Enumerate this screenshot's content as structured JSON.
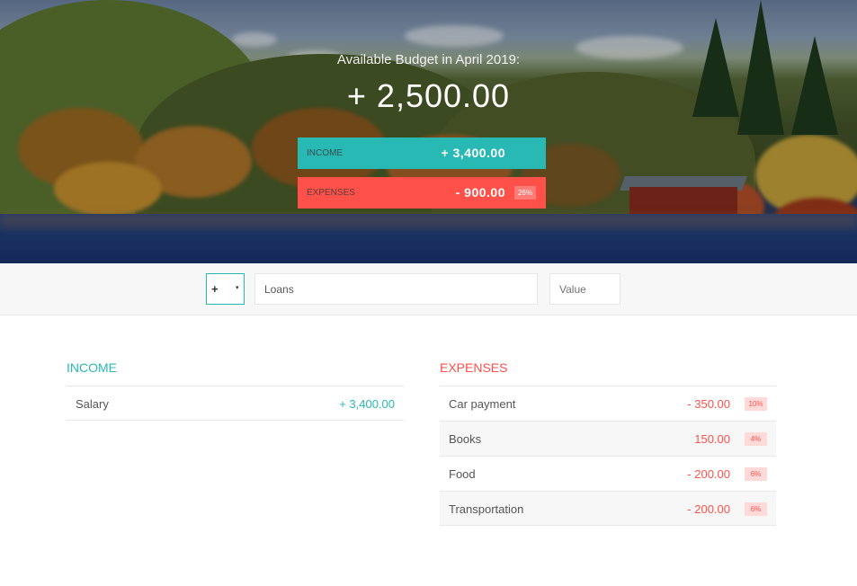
{
  "header": {
    "title": "Available Budget in April 2019:",
    "budget": "+ 2,500.00",
    "income": {
      "label": "Income",
      "value": "+ 3,400.00"
    },
    "expenses": {
      "label": "Expenses",
      "value": "- 900.00",
      "percentage": "26%"
    }
  },
  "add_form": {
    "type_value": "+",
    "type_caret": "▾",
    "description_value": "Loans",
    "value_placeholder": "Value"
  },
  "income": {
    "title": "Income",
    "items": [
      {
        "description": "Salary",
        "value": "+ 3,400.00"
      }
    ]
  },
  "expenses": {
    "title": "Expenses",
    "items": [
      {
        "description": "Car payment",
        "value": "- 350.00",
        "percentage": "10%"
      },
      {
        "description": "Books",
        "value": "150.00",
        "percentage": "4%"
      },
      {
        "description": "Food",
        "value": "- 200.00",
        "percentage": "6%"
      },
      {
        "description": "Transportation",
        "value": "- 200.00",
        "percentage": "6%"
      }
    ]
  },
  "colors": {
    "income_accent": "#28b9b5",
    "expenses_accent": "#ff5049"
  }
}
